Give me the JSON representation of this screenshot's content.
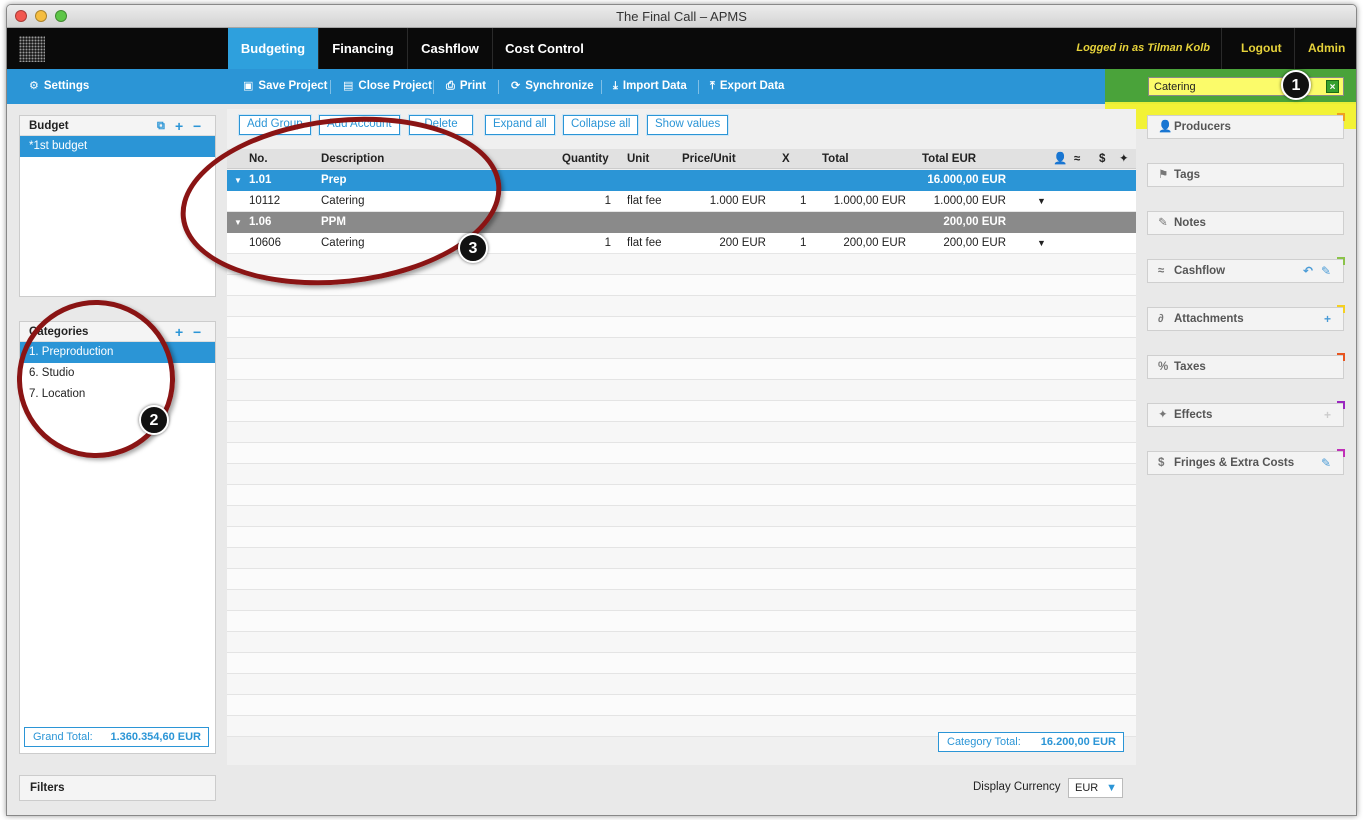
{
  "window": {
    "title": "The Final Call – APMS"
  },
  "nav": {
    "tabs": [
      "Budgeting",
      "Financing",
      "Cashflow",
      "Cost Control"
    ],
    "logged_in": "Logged in as Tilman Kolb",
    "logout": "Logout",
    "admin": "Admin"
  },
  "toolbar": {
    "settings": "Settings",
    "save": "Save Project",
    "close": "Close Project",
    "print": "Print",
    "sync": "Synchronize",
    "import": "Import Data",
    "export": "Export Data"
  },
  "search": {
    "value": "Catering",
    "clear_icon": "x-icon"
  },
  "budget_panel": {
    "title": "Budget",
    "items": [
      "*1st budget"
    ]
  },
  "categories_panel": {
    "title": "Categories",
    "items": [
      "1. Preproduction",
      "6. Studio",
      "7. Location"
    ]
  },
  "grand_total": {
    "label": "Grand Total:",
    "value": "1.360.354,60 EUR"
  },
  "actions": [
    "Add Group",
    "Add Account",
    "Delete",
    "Expand all",
    "Collapse all",
    "Show values"
  ],
  "table": {
    "headers": [
      "No.",
      "Description",
      "Quantity",
      "Unit",
      "Price/Unit",
      "X",
      "Total",
      "Total EUR"
    ],
    "groups": [
      {
        "no": "1.01",
        "desc": "Prep",
        "total_eur": "16.000,00 EUR",
        "rows": [
          {
            "no": "10112",
            "desc": "Catering",
            "qty": "1",
            "unit": "flat fee",
            "price": "1.000 EUR",
            "x": "1",
            "total": "1.000,00 EUR",
            "total_eur": "1.000,00 EUR"
          }
        ]
      },
      {
        "no": "1.06",
        "desc": "PPM",
        "total_eur": "200,00 EUR",
        "rows": [
          {
            "no": "10606",
            "desc": "Catering",
            "qty": "1",
            "unit": "flat fee",
            "price": "200 EUR",
            "x": "1",
            "total": "200,00 EUR",
            "total_eur": "200,00 EUR"
          }
        ]
      }
    ]
  },
  "category_total": {
    "label": "Category Total:",
    "value": "16.200,00 EUR"
  },
  "side_buttons": [
    {
      "label": "Producers",
      "icon": "person-icon",
      "corner": "#f0a020"
    },
    {
      "label": "Tags",
      "icon": "flag-icon",
      "corner": ""
    },
    {
      "label": "Notes",
      "icon": "pencil-icon",
      "corner": ""
    },
    {
      "label": "Cashflow",
      "icon": "chart-icon",
      "corner": "#8bc34a"
    },
    {
      "label": "Attachments",
      "icon": "paperclip-icon",
      "corner": "#f5d020"
    },
    {
      "label": "Taxes",
      "icon": "percent-icon",
      "corner": "#e8551f"
    },
    {
      "label": "Effects",
      "icon": "effects-icon",
      "corner": "#9b27c0"
    },
    {
      "label": "Fringes & Extra Costs",
      "icon": "dollar-icon",
      "corner": "#c02fb8"
    }
  ],
  "filters": {
    "label": "Filters"
  },
  "currency": {
    "label": "Display Currency",
    "value": "EUR"
  },
  "callouts": [
    "1",
    "2",
    "3"
  ]
}
